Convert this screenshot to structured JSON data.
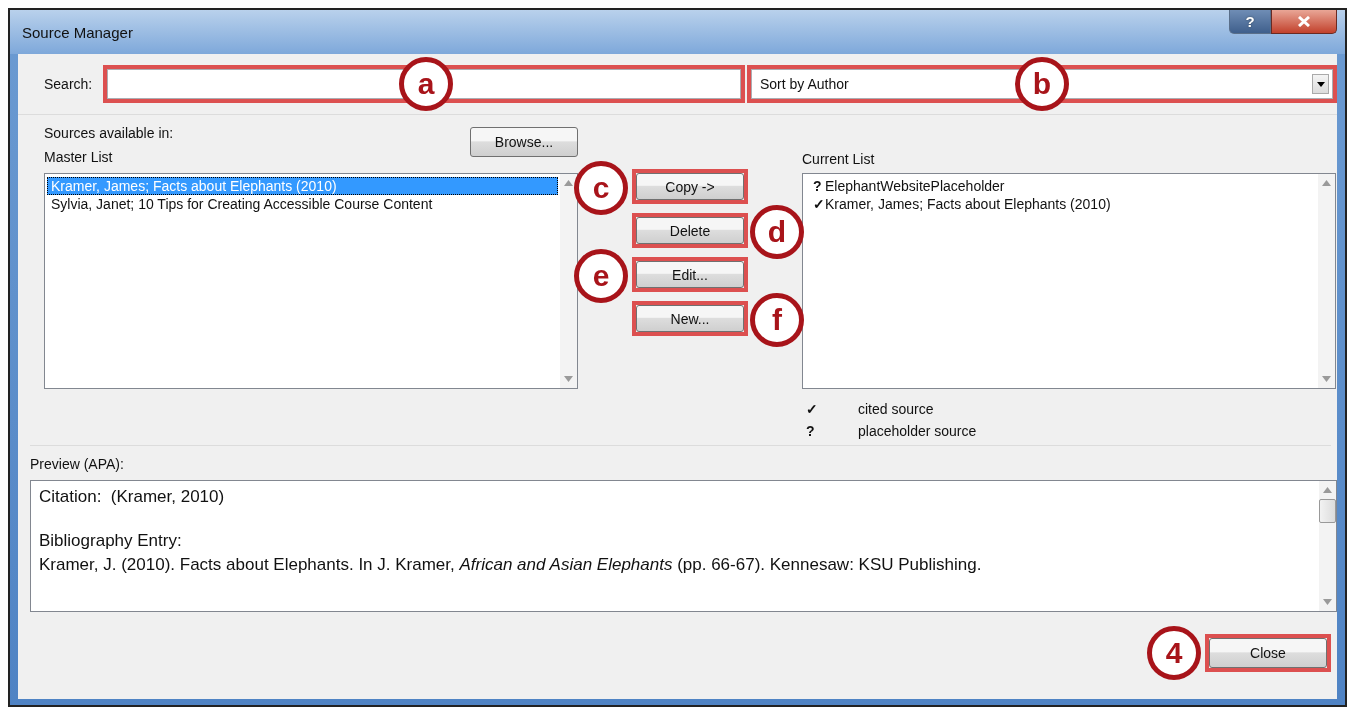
{
  "window": {
    "title": "Source Manager",
    "help_button": "?"
  },
  "search": {
    "label": "Search:",
    "callout": "a",
    "highlighted": true
  },
  "sort": {
    "value": "Sort by Author",
    "callout": "b",
    "highlighted": true
  },
  "sources_label": "Sources available in:",
  "browse_button": {
    "label": "Browse..."
  },
  "master_list": {
    "label": "Master List",
    "items": [
      {
        "text": "Kramer, James; Facts about Elephants (2010)",
        "selected": true
      },
      {
        "text": "Sylvia, Janet; 10 Tips for Creating Accessible Course Content",
        "selected": false
      }
    ]
  },
  "actions": [
    {
      "label": "Copy ->",
      "callout": "c",
      "highlighted": true
    },
    {
      "label": "Delete",
      "callout": "d",
      "highlighted": true
    },
    {
      "label": "Edit...",
      "callout": "e",
      "highlighted": true
    },
    {
      "label": "New...",
      "callout": "f",
      "highlighted": true
    }
  ],
  "current_list": {
    "label": "Current List",
    "items": [
      {
        "mark": "?",
        "text": "ElephantWebsitePlaceholder"
      },
      {
        "mark": "✓",
        "text": "Kramer, James; Facts about Elephants (2010)"
      }
    ]
  },
  "legend": [
    {
      "mark": "✓",
      "text": "cited source"
    },
    {
      "mark": "?",
      "text": "placeholder source"
    }
  ],
  "preview": {
    "label": "Preview (APA):",
    "lines": [
      {
        "kind": "citation",
        "text": "Citation:  (Kramer, 2010)"
      },
      {
        "kind": "heading",
        "text": "Bibliography Entry:"
      },
      {
        "kind": "entry",
        "text": "Kramer, J. (2010). Facts about Elephants. In J. Kramer, *African and Asian Elephants* (pp. 66-67). Kennesaw: KSU Publishing."
      }
    ]
  },
  "close_button": {
    "label": "Close",
    "callout": "4",
    "highlighted": true
  }
}
